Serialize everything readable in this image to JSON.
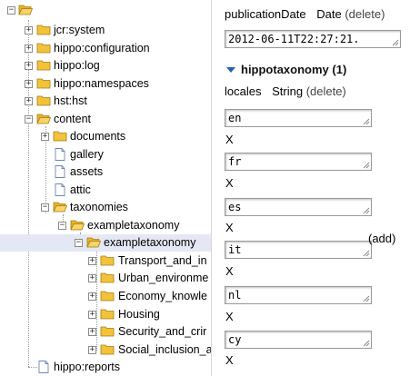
{
  "tree": {
    "items": [
      {
        "label": "",
        "expander": "minus",
        "icon": "folder-open-icon"
      },
      {
        "label": "jcr:system",
        "expander": "plus",
        "icon": "folder-icon"
      },
      {
        "label": "hippo:configuration",
        "expander": "plus",
        "icon": "folder-icon"
      },
      {
        "label": "hippo:log",
        "expander": "plus",
        "icon": "folder-icon"
      },
      {
        "label": "hippo:namespaces",
        "expander": "plus",
        "icon": "folder-icon"
      },
      {
        "label": "hst:hst",
        "expander": "plus",
        "icon": "folder-icon"
      },
      {
        "label": "content",
        "expander": "minus",
        "icon": "folder-open-icon"
      },
      {
        "label": "documents",
        "expander": "plus",
        "icon": "folder-icon"
      },
      {
        "label": "gallery",
        "expander": "",
        "icon": "document-icon"
      },
      {
        "label": "assets",
        "expander": "",
        "icon": "document-icon"
      },
      {
        "label": "attic",
        "expander": "",
        "icon": "document-icon"
      },
      {
        "label": "taxonomies",
        "expander": "minus",
        "icon": "folder-open-icon"
      },
      {
        "label": "exampletaxonomy",
        "expander": "minus",
        "icon": "folder-open-icon"
      },
      {
        "label": "exampletaxonomy",
        "expander": "minus",
        "icon": "folder-open-icon"
      },
      {
        "label": "Transport_and_in",
        "expander": "plus",
        "icon": "folder-icon"
      },
      {
        "label": "Urban_environme",
        "expander": "plus",
        "icon": "folder-icon"
      },
      {
        "label": "Economy_knowle",
        "expander": "plus",
        "icon": "folder-icon"
      },
      {
        "label": "Housing",
        "expander": "plus",
        "icon": "folder-icon"
      },
      {
        "label": "Security_and_crir",
        "expander": "plus",
        "icon": "folder-icon"
      },
      {
        "label": "Social_inclusion_a",
        "expander": "plus",
        "icon": "folder-icon"
      },
      {
        "label": "hippo:reports",
        "expander": "",
        "icon": "document-icon"
      }
    ]
  },
  "properties": {
    "publication": {
      "name": "publicationDate",
      "type": "Date",
      "delete": "(delete)",
      "value": "2012-06-11T22:27:21."
    },
    "section": {
      "title": "hippotaxonomy (1)"
    },
    "locales": {
      "name": "locales",
      "type": "String",
      "delete": "(delete)",
      "add": "(add)",
      "remove_label": "X",
      "values": [
        "en",
        "fr",
        "es",
        "it",
        "nl",
        "cy"
      ]
    }
  },
  "colors": {
    "selected_row": "#e3e8f4",
    "triangle": "#2a5db0",
    "folder": "#f2c23a"
  }
}
